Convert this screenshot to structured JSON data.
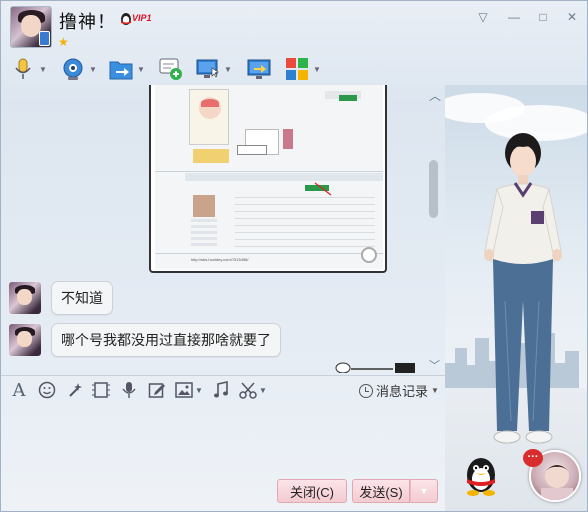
{
  "title": {
    "nickname": "撸神！",
    "vip_label": "VIP1",
    "level_icon": "star-icon"
  },
  "window_controls": {
    "dropdown": "▽",
    "minimize": "—",
    "maximize": "□",
    "close": "✕"
  },
  "toolbar": {
    "items": [
      {
        "name": "voice",
        "icon": "microphone-icon"
      },
      {
        "name": "video",
        "icon": "webcam-icon"
      },
      {
        "name": "file",
        "icon": "folder-transfer-icon"
      },
      {
        "name": "group",
        "icon": "chat-add-icon"
      },
      {
        "name": "remote",
        "icon": "remote-desktop-icon"
      },
      {
        "name": "share-screen",
        "icon": "screen-share-icon"
      },
      {
        "name": "apps",
        "icon": "apps-grid-icon"
      }
    ]
  },
  "chat": {
    "messages": [
      {
        "sender": "撸神！",
        "text": "不知道"
      },
      {
        "sender": "撸神！",
        "text": "哪个号我都没用过直接那啥就要了"
      }
    ],
    "screenshot_caption": "http://sbs.hooldey.com/7515458/"
  },
  "input_toolbar": {
    "history_label": "消息记录"
  },
  "buttons": {
    "close_label": "关闭(C)",
    "send_label": "发送(S)"
  },
  "notification": {
    "count": "···"
  },
  "colors": {
    "button_pink": "#f4cbd2",
    "window_bg": "#e4ebf3",
    "accent_blue": "#2f7fd1"
  }
}
